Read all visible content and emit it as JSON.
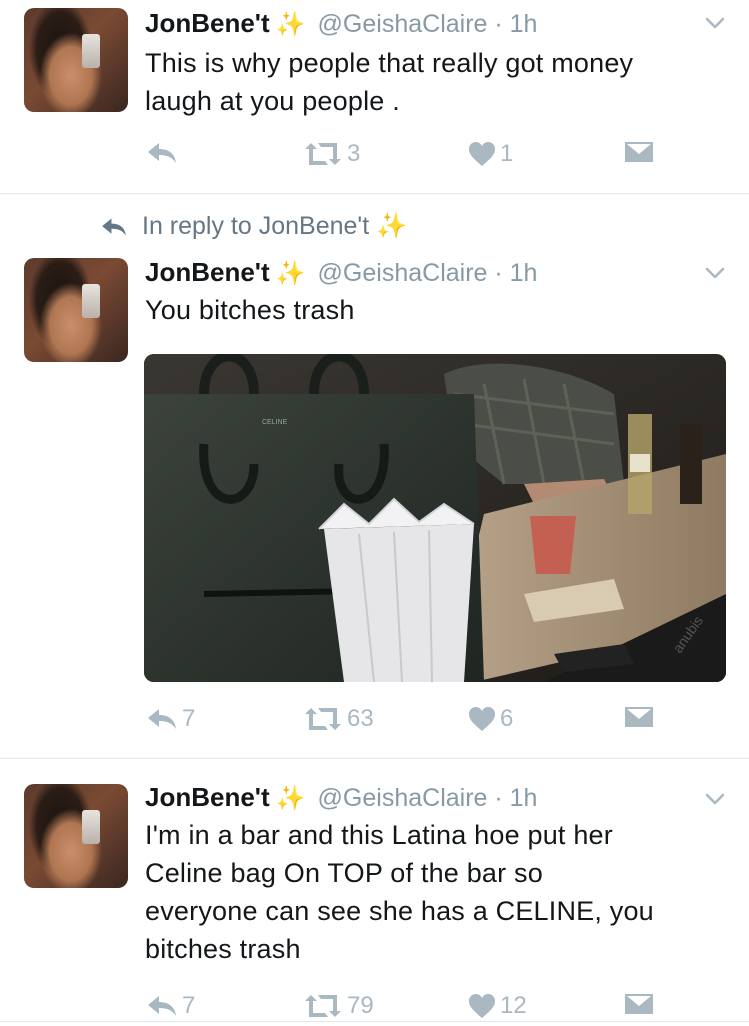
{
  "tweets": [
    {
      "name": "JonBene't",
      "emoji": "✨",
      "handle": "@GeishaClaire",
      "time": "1h",
      "text_lines": [
        "This is why people that really got money",
        "laugh at you people ."
      ],
      "reply_count": "",
      "retweet_count": "3",
      "like_count": "1"
    },
    {
      "reply_context": "In reply to JonBene't ✨",
      "name": "JonBene't",
      "emoji": "✨",
      "handle": "@GeishaClaire",
      "time": "1h",
      "text_lines": [
        "You bitches trash"
      ],
      "image_alt": "Black Celine handbag on a bar counter next to a cup of napkins and drinks",
      "image_label": "CELINE",
      "reply_count": "7",
      "retweet_count": "63",
      "like_count": "6"
    },
    {
      "name": "JonBene't",
      "emoji": "✨",
      "handle": "@GeishaClaire",
      "time": "1h",
      "text_lines": [
        "I'm in a bar and this Latina hoe put her",
        "Celine bag On TOP of the bar so",
        "everyone can see she has a CELINE, you",
        "bitches trash"
      ],
      "reply_count": "7",
      "retweet_count": "79",
      "like_count": "12"
    }
  ],
  "colors": {
    "text": "#14171a",
    "secondary": "#8899a6",
    "action_icon": "#aab8c2",
    "divider": "#e1e8ed",
    "sparkle": "#f5c542"
  },
  "icons": [
    "reply-icon",
    "retweet-icon",
    "like-icon",
    "direct-message-icon",
    "chevron-down-icon",
    "sparkles-emoji"
  ]
}
